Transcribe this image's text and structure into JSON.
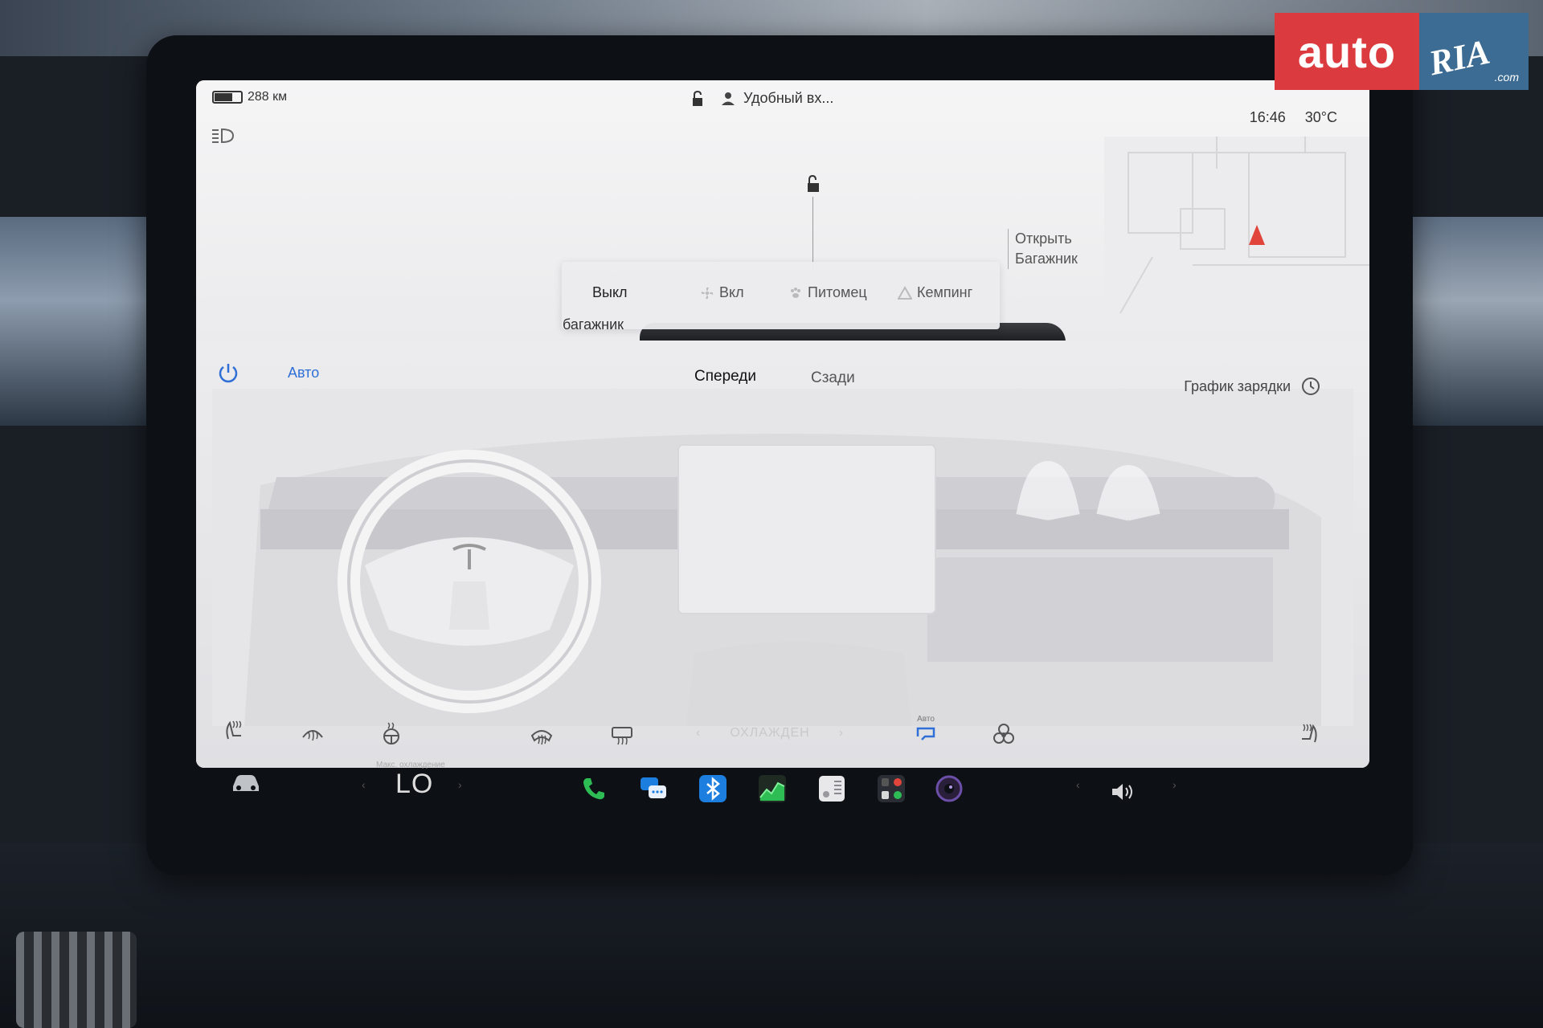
{
  "status_bar": {
    "range": "288 км",
    "profile": "Удобный вх...",
    "time": "16:46",
    "outside_temp": "30°C"
  },
  "map": {
    "open_trunk_line1": "Открыть",
    "open_trunk_line2": "Багажник",
    "trunk_fragment": "багажник"
  },
  "camp_mode": {
    "options": [
      "Выкл",
      "Вкл",
      "Питомец",
      "Кемпинг"
    ],
    "selected": "Выкл"
  },
  "climate": {
    "auto_label": "Авто",
    "tabs": [
      "Спереди",
      "Сзади"
    ],
    "active_tab": "Спереди",
    "charge_schedule": "График зарядки",
    "cooling_mode": "ОХЛАЖДЕН",
    "recirc_label": "Авто"
  },
  "bottom_bar": {
    "max_cool_label": "Макс. охлаждение",
    "temperature": "LO",
    "apps": [
      "phone-icon",
      "messages-icon",
      "bluetooth-icon",
      "energy-icon",
      "toybox-icon",
      "media-icon",
      "camera-icon"
    ]
  },
  "watermark": {
    "auto": "auto",
    "ria": "RIA",
    "com": ".com"
  },
  "colors": {
    "accent_blue": "#2f6fd6",
    "phone_green": "#2ebd54",
    "bluetooth_blue": "#1c7fe0",
    "nav_red": "#e0443a"
  }
}
